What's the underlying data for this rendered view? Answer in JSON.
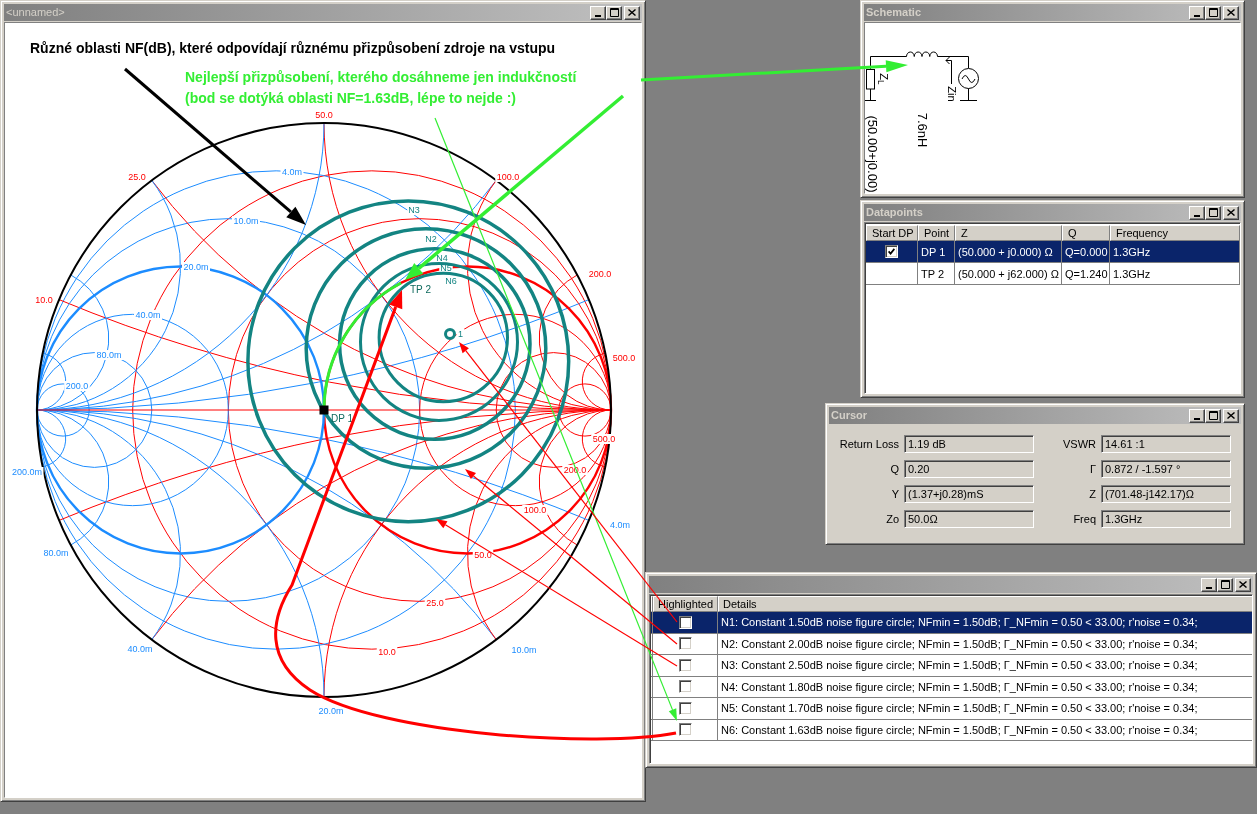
{
  "chart_window": {
    "title": "<unnamed>",
    "heading": "Různé oblasti NF(dB), které odpovídají různému přizpůsobení zdroje na vstupu",
    "note": "Nejlepší přizpůsobení, kterého dosáhneme jen indukčností\n(bod se dotýká oblasti NF=1.63dB, lépe to nejde :)",
    "smith_chart": {
      "reactance_labels": [
        "50.0",
        "25.0",
        "100.0",
        "10.0",
        "200.0",
        "500.0"
      ],
      "resistance_labels": [
        "500.0",
        "200.0",
        "100.0",
        "50.0",
        "25.0",
        "10.0"
      ],
      "conductance_labels": [
        "4.0m",
        "10.0m",
        "20.0m",
        "40.0m",
        "80.0m",
        "200.0"
      ],
      "susceptance_labels": [
        "200.0m",
        "80.0m",
        "40.0m",
        "20.0m",
        "10.0m",
        "4.0m"
      ],
      "noise_circles": [
        {
          "label": "1"
        },
        {
          "label": "N2"
        },
        {
          "label": "N3"
        },
        {
          "label": "N4"
        },
        {
          "label": "N5"
        },
        {
          "label": "N6"
        }
      ],
      "points": [
        {
          "label": "DP 1"
        },
        {
          "label": "TP 2"
        }
      ]
    }
  },
  "schematic_window": {
    "title": "Schematic",
    "load_label": "Z$_{L}$",
    "input_label": "Zin",
    "load_value": "(50.00+j0.00)",
    "inductor_value": "7.6nH"
  },
  "datapoints_window": {
    "title": "Datapoints",
    "columns": [
      "Start DP",
      "Point",
      "Z",
      "Q",
      "Frequency"
    ],
    "rows": [
      {
        "selected": true,
        "start_dp": true,
        "point": "DP 1",
        "z": "(50.000 + j0.000) Ω",
        "q": "Q=0.000",
        "frequency": "1.3GHz"
      },
      {
        "selected": false,
        "start_dp": false,
        "point": "TP 2",
        "z": "(50.000 + j62.000) Ω",
        "q": "Q=1.240",
        "frequency": "1.3GHz"
      }
    ]
  },
  "cursor_window": {
    "title": "Cursor",
    "fields": [
      {
        "label": "Return Loss",
        "value": "1.19 dB"
      },
      {
        "label": "VSWR",
        "value": "14.61 :1"
      },
      {
        "label": "Q",
        "value": "0.20"
      },
      {
        "label": "Γ",
        "value": "0.872 / -1.597 °"
      },
      {
        "label": "Y",
        "value": "(1.37+j0.28)mS"
      },
      {
        "label": "Z",
        "value": "(701.48-j142.17)Ω"
      },
      {
        "label": "Zo",
        "value": "50.0Ω"
      },
      {
        "label": "Freq",
        "value": "1.3GHz"
      }
    ]
  },
  "noise_window": {
    "columns": [
      "Highlighted",
      "Details"
    ],
    "rows": [
      {
        "selected": true,
        "highlighted": false,
        "details": "N1: Constant 1.50dB noise figure circle; NFmin = 1.50dB; Γ_NFmin = 0.50 < 33.00; r'noise = 0.34;"
      },
      {
        "selected": false,
        "highlighted": false,
        "details": "N2: Constant 2.00dB noise figure circle; NFmin = 1.50dB; Γ_NFmin = 0.50 < 33.00; r'noise = 0.34;"
      },
      {
        "selected": false,
        "highlighted": false,
        "details": "N3: Constant 2.50dB noise figure circle; NFmin = 1.50dB; Γ_NFmin = 0.50 < 33.00; r'noise = 0.34;"
      },
      {
        "selected": false,
        "highlighted": false,
        "details": "N4: Constant 1.80dB noise figure circle; NFmin = 1.50dB; Γ_NFmin = 0.50 < 33.00; r'noise = 0.34;"
      },
      {
        "selected": false,
        "highlighted": false,
        "details": "N5: Constant 1.70dB noise figure circle; NFmin = 1.50dB; Γ_NFmin = 0.50 < 33.00; r'noise = 0.34;"
      },
      {
        "selected": false,
        "highlighted": false,
        "details": "N6: Constant 1.63dB noise figure circle; NFmin = 1.50dB; Γ_NFmin = 0.50 < 33.00; r'noise = 0.34;"
      }
    ]
  }
}
